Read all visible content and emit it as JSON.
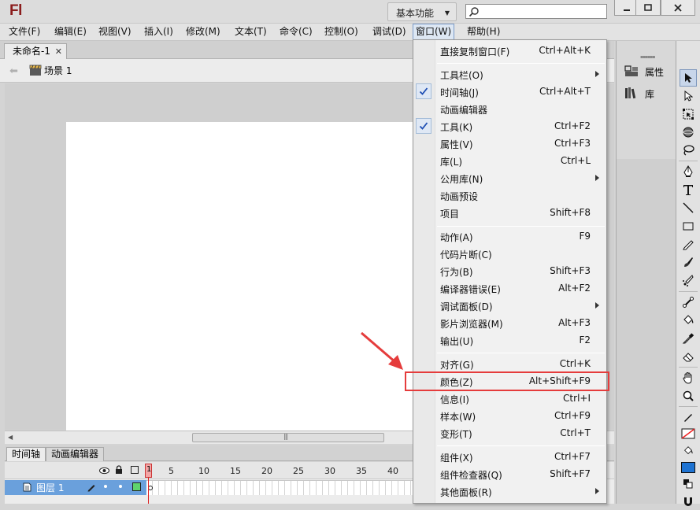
{
  "titlebar": {
    "logo": "Fl",
    "workspace": "基本功能",
    "search_placeholder": ""
  },
  "menubar": {
    "items": [
      "文件(F)",
      "编辑(E)",
      "视图(V)",
      "插入(I)",
      "修改(M)",
      "文本(T)",
      "命令(C)",
      "控制(O)",
      "调试(D)",
      "窗口(W)",
      "帮助(H)"
    ],
    "active": "窗口(W)"
  },
  "document": {
    "tab": "未命名-1",
    "scene": "场景 1"
  },
  "timeline": {
    "tabs": [
      "时间轴",
      "动画编辑器"
    ],
    "frame_numbers": [
      "1",
      "5",
      "10",
      "15",
      "20",
      "25",
      "30",
      "35",
      "40"
    ],
    "layer_name": "图层 1"
  },
  "panels": {
    "properties": "属性",
    "library": "库"
  },
  "window_menu": {
    "groups": [
      [
        {
          "label": "直接复制窗口(F)",
          "shortcut": "Ctrl+Alt+K"
        }
      ],
      [
        {
          "label": "工具栏(O)",
          "shortcut": "",
          "submenu": true
        },
        {
          "label": "时间轴(J)",
          "shortcut": "Ctrl+Alt+T",
          "checked": true
        },
        {
          "label": "动画编辑器",
          "shortcut": ""
        },
        {
          "label": "工具(K)",
          "shortcut": "Ctrl+F2",
          "checked": true
        },
        {
          "label": "属性(V)",
          "shortcut": "Ctrl+F3"
        },
        {
          "label": "库(L)",
          "shortcut": "Ctrl+L"
        },
        {
          "label": "公用库(N)",
          "shortcut": "",
          "submenu": true
        },
        {
          "label": "动画预设",
          "shortcut": ""
        },
        {
          "label": "项目",
          "shortcut": "Shift+F8"
        }
      ],
      [
        {
          "label": "动作(A)",
          "shortcut": "F9"
        },
        {
          "label": "代码片断(C)",
          "shortcut": ""
        },
        {
          "label": "行为(B)",
          "shortcut": "Shift+F3"
        },
        {
          "label": "编译器错误(E)",
          "shortcut": "Alt+F2"
        },
        {
          "label": "调试面板(D)",
          "shortcut": "",
          "submenu": true
        },
        {
          "label": "影片浏览器(M)",
          "shortcut": "Alt+F3"
        },
        {
          "label": "输出(U)",
          "shortcut": "F2"
        }
      ],
      [
        {
          "label": "对齐(G)",
          "shortcut": "Ctrl+K"
        },
        {
          "label": "颜色(Z)",
          "shortcut": "Alt+Shift+F9",
          "highlighted": true
        },
        {
          "label": "信息(I)",
          "shortcut": "Ctrl+I"
        },
        {
          "label": "样本(W)",
          "shortcut": "Ctrl+F9"
        },
        {
          "label": "变形(T)",
          "shortcut": "Ctrl+T"
        }
      ],
      [
        {
          "label": "组件(X)",
          "shortcut": "Ctrl+F7"
        },
        {
          "label": "组件检查器(Q)",
          "shortcut": "Shift+F7"
        },
        {
          "label": "其他面板(R)",
          "shortcut": "",
          "submenu": true
        }
      ]
    ]
  },
  "colors": {
    "highlight": "#e53c3c",
    "check": "#1f4fb4",
    "layer_selected": "#6aa0dc",
    "fill_swatch": "#1e73d2"
  }
}
